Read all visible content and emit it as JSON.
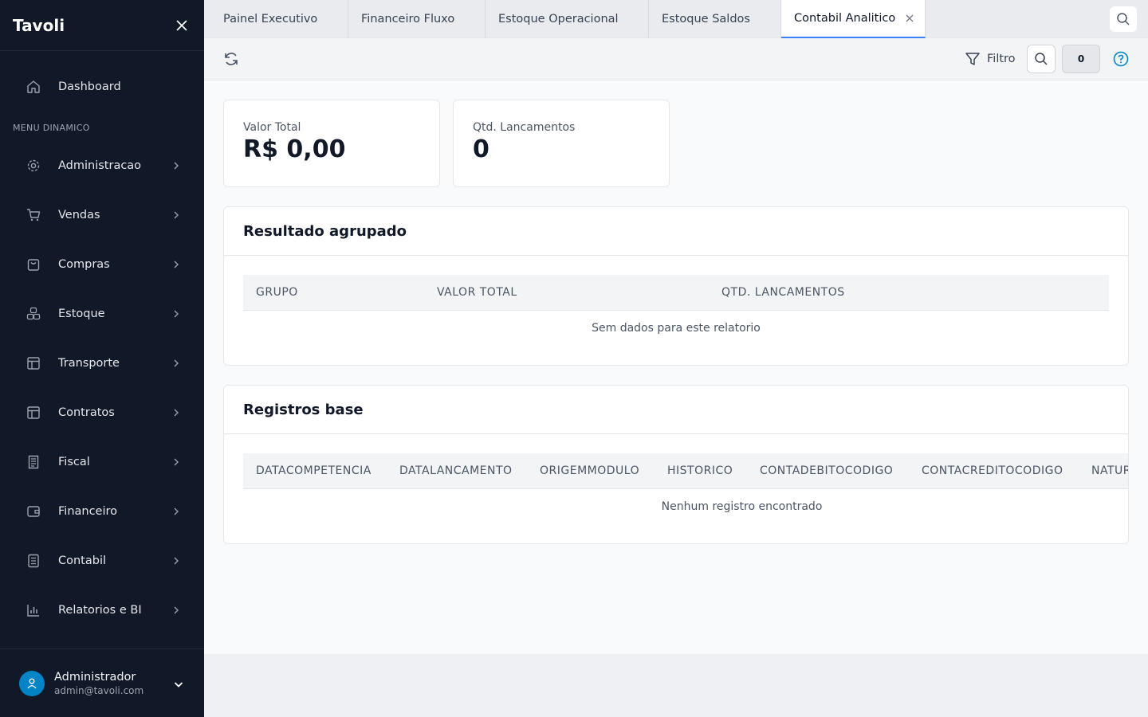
{
  "app": {
    "title": "Tavoli"
  },
  "sidebar": {
    "dashboard_label": "Dashboard",
    "menu_heading": "MENU DINAMICO",
    "items": [
      {
        "label": "Administracao",
        "icon": "gear-icon"
      },
      {
        "label": "Vendas",
        "icon": "cart-icon"
      },
      {
        "label": "Compras",
        "icon": "bag-icon"
      },
      {
        "label": "Estoque",
        "icon": "boxes-icon"
      },
      {
        "label": "Transporte",
        "icon": "layout-icon"
      },
      {
        "label": "Contratos",
        "icon": "layout-icon"
      },
      {
        "label": "Fiscal",
        "icon": "receipt-icon"
      },
      {
        "label": "Financeiro",
        "icon": "wallet-icon"
      },
      {
        "label": "Contabil",
        "icon": "ledger-icon"
      },
      {
        "label": "Relatorios e BI",
        "icon": "bar-chart-icon"
      }
    ],
    "user": {
      "name": "Administrador",
      "email": "admin@tavoli.com"
    }
  },
  "tabs": [
    {
      "label": "Painel Executivo",
      "active": false
    },
    {
      "label": "Financeiro Fluxo",
      "active": false
    },
    {
      "label": "Estoque Operacional",
      "active": false
    },
    {
      "label": "Estoque Saldos",
      "active": false
    },
    {
      "label": "Contabil Analitico",
      "active": true
    }
  ],
  "toolbar": {
    "filter_label": "Filtro",
    "count": "0"
  },
  "stats": [
    {
      "label": "Valor Total",
      "value": "R$ 0,00"
    },
    {
      "label": "Qtd. Lancamentos",
      "value": "0"
    }
  ],
  "grouped": {
    "title": "Resultado agrupado",
    "columns": [
      "GRUPO",
      "VALOR TOTAL",
      "QTD. LANCAMENTOS"
    ],
    "empty_text": "Sem dados para este relatorio"
  },
  "records": {
    "title": "Registros base",
    "columns": [
      "DATACOMPETENCIA",
      "DATALANCAMENTO",
      "ORIGEMMODULO",
      "HISTORICO",
      "CONTADEBITOCODIGO",
      "CONTACREDITOCODIGO",
      "NATUR"
    ],
    "empty_text": "Nenhum registro encontrado"
  },
  "colors": {
    "sidebar_bg": "#111827",
    "accent": "#3b82f6",
    "avatar": "#0284c7",
    "help": "#0284c7"
  }
}
